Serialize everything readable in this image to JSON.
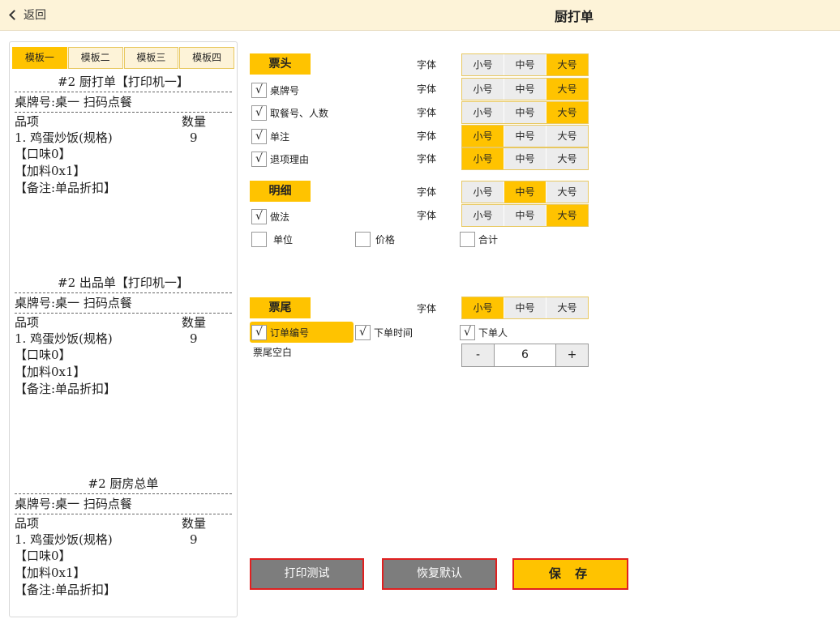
{
  "header": {
    "back_label": "返回",
    "title": "厨打单"
  },
  "templates": {
    "tabs": [
      "模板一",
      "模板二",
      "模板三",
      "模板四"
    ],
    "active_index": 0
  },
  "preview": {
    "tickets": [
      {
        "title": "#2 厨打单【打印机一】",
        "table_line": "桌牌号:桌一  扫码点餐",
        "col_item": "品项",
        "col_qty": "数量",
        "item": "1. 鸡蛋炒饭(规格)",
        "qty": "9",
        "subs": [
          "【口味0】",
          "【加料0x1】",
          "【备注:单品折扣】"
        ]
      },
      {
        "title": "#2 出品单【打印机一】",
        "table_line": "桌牌号:桌一  扫码点餐",
        "col_item": "品项",
        "col_qty": "数量",
        "item": "1. 鸡蛋炒饭(规格)",
        "qty": "9",
        "subs": [
          "【口味0】",
          "【加料0x1】",
          "【备注:单品折扣】"
        ]
      },
      {
        "title": "#2 厨房总单",
        "table_line": "桌牌号:桌一  扫码点餐",
        "col_item": "品项",
        "col_qty": "数量",
        "item": "1. 鸡蛋炒饭(规格)",
        "qty": "9",
        "subs": [
          "【口味0】",
          "【加料0x1】",
          "【备注:单品折扣】"
        ]
      }
    ]
  },
  "font_label": "字体",
  "sizes": [
    "小号",
    "中号",
    "大号"
  ],
  "header_section": {
    "tag": "票头",
    "tag_size_selected": 2,
    "rows": [
      {
        "label": "桌牌号",
        "checked": true,
        "size_selected": 2
      },
      {
        "label": "取餐号、人数",
        "checked": true,
        "size_selected": 2
      },
      {
        "label": "单注",
        "checked": true,
        "size_selected": 0
      },
      {
        "label": "退项理由",
        "checked": true,
        "size_selected": 0
      }
    ]
  },
  "detail_section": {
    "tag": "明细",
    "tag_size_selected": 1,
    "method": {
      "label": "做法",
      "checked": true,
      "size_selected": 2
    },
    "unit": {
      "label": "单位",
      "checked": false
    },
    "price": {
      "label": "价格",
      "checked": false
    },
    "total": {
      "label": "合计",
      "checked": false
    }
  },
  "footer_section": {
    "tag": "票尾",
    "tag_size_selected": 0,
    "order_no": {
      "label": "订单编号",
      "checked": true
    },
    "order_time": {
      "label": "下单时间",
      "checked": true
    },
    "orderer": {
      "label": "下单人",
      "checked": true
    },
    "blank_label": "票尾空白",
    "blank_value": "6",
    "minus": "-",
    "plus": "+"
  },
  "actions": {
    "print_test": "打印测试",
    "restore": "恢复默认",
    "save": "保 存"
  },
  "check_mark": "√"
}
